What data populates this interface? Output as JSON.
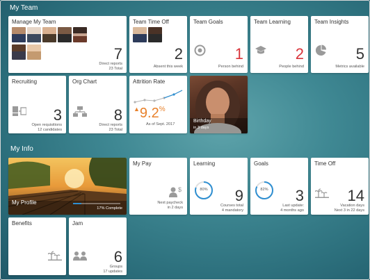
{
  "sections": {
    "my_team": "My Team",
    "my_info": "My Info"
  },
  "team": {
    "manage": {
      "title": "Manage My Team",
      "count": "7",
      "line1": "Direct reports",
      "line2": "23 Total"
    },
    "time_off": {
      "title": "Team Time Off",
      "count": "2",
      "line1": "Absent this week"
    },
    "goals": {
      "title": "Team Goals",
      "count": "1",
      "line1": "Person behind"
    },
    "learning": {
      "title": "Team Learning",
      "count": "2",
      "line1": "People behind"
    },
    "insights": {
      "title": "Team Insights",
      "count": "5",
      "line1": "Metrics available"
    },
    "recruiting": {
      "title": "Recruiting",
      "count": "3",
      "line1": "Open requisitions",
      "line2": "12 candidates"
    },
    "org_chart": {
      "title": "Org Chart",
      "count": "8",
      "line1": "Direct reports",
      "line2": "23 Total"
    },
    "attrition": {
      "title": "Attrition Rate",
      "value": "9.2",
      "unit": "%",
      "line1": "As of Sept. 2017"
    },
    "birthday": {
      "title": "Birthday",
      "line1": "in 3 days"
    }
  },
  "info": {
    "profile": {
      "title": "My Profile",
      "progress_label": "17% Complete",
      "progress": 17
    },
    "pay": {
      "title": "My Pay",
      "line1": "Next paycheck",
      "line2": "in 2 days"
    },
    "learning": {
      "title": "Learning",
      "ring": "80%",
      "ring_value": 80,
      "count": "9",
      "line1": "Courses total",
      "line2": "4 mandatory"
    },
    "goals": {
      "title": "Goals",
      "ring": "82%",
      "ring_value": 82,
      "count": "3",
      "line1": "Last update:",
      "line2": "4 months ago"
    },
    "time_off": {
      "title": "Time Off",
      "count": "14",
      "line1": "Vacation days",
      "line2": "Next 3 in 22 days"
    },
    "benefits": {
      "title": "Benefits"
    },
    "jam": {
      "title": "Jam",
      "count": "6",
      "line1": "Groups",
      "line2": "17 updates"
    }
  },
  "colors": {
    "accent_red": "#d9343b",
    "accent_orange": "#e8812b",
    "accent_blue": "#2f8fd1",
    "background": "#3f8893"
  }
}
